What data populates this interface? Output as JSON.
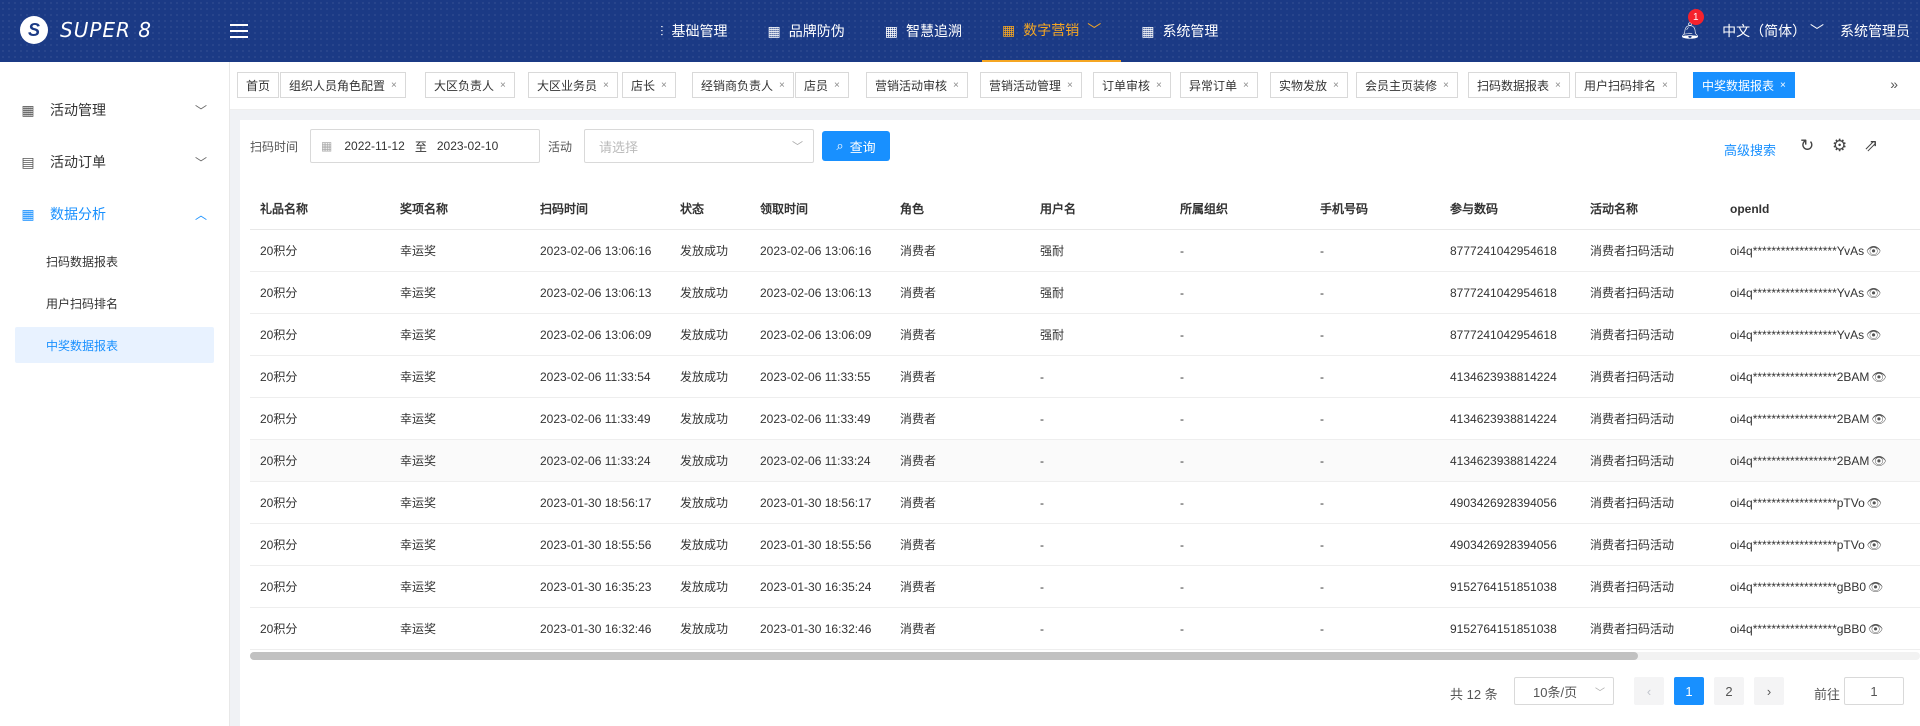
{
  "header": {
    "logo_text": "SUPER 8",
    "nav": [
      {
        "label": "基础管理",
        "icon": "sliders-icon",
        "active": false
      },
      {
        "label": "品牌防伪",
        "icon": "grid-icon",
        "active": false
      },
      {
        "label": "智慧追溯",
        "icon": "grid-icon",
        "active": false
      },
      {
        "label": "数字营销",
        "icon": "grid-icon",
        "active": true
      },
      {
        "label": "系统管理",
        "icon": "grid-icon",
        "active": false
      }
    ],
    "notification_count": "1",
    "language": "中文（简体）",
    "user": "系统管理员",
    "accent_color": "#f5a623",
    "bg_color": "#1b3a85"
  },
  "sidebar": {
    "groups": [
      {
        "label": "活动管理",
        "icon": "grid-icon",
        "open": false
      },
      {
        "label": "活动订单",
        "icon": "document-icon",
        "open": false
      },
      {
        "label": "数据分析",
        "icon": "grid-icon",
        "open": true
      }
    ],
    "subitems": [
      {
        "label": "扫码数据报表",
        "active": false
      },
      {
        "label": "用户扫码排名",
        "active": false
      },
      {
        "label": "中奖数据报表",
        "active": true
      }
    ]
  },
  "tabs": [
    {
      "label": "首页",
      "closable": false
    },
    {
      "label": "组织人员角色配置",
      "closable": true
    },
    {
      "label": "大区负责人",
      "closable": true
    },
    {
      "label": "大区业务员",
      "closable": true
    },
    {
      "label": "店长",
      "closable": true
    },
    {
      "label": "经销商负责人",
      "closable": true
    },
    {
      "label": "店员",
      "closable": true
    },
    {
      "label": "营销活动审核",
      "closable": true
    },
    {
      "label": "营销活动管理",
      "closable": true
    },
    {
      "label": "订单审核",
      "closable": true
    },
    {
      "label": "异常订单",
      "closable": true
    },
    {
      "label": "实物发放",
      "closable": true
    },
    {
      "label": "会员主页装修",
      "closable": true
    },
    {
      "label": "扫码数据报表",
      "closable": true
    },
    {
      "label": "用户扫码排名",
      "closable": true
    },
    {
      "label": "中奖数据报表",
      "closable": true,
      "active": true
    }
  ],
  "filters": {
    "scan_time_label": "扫码时间",
    "date_start": "2022-11-12",
    "date_sep": "至",
    "date_end": "2023-02-10",
    "activity_label": "活动",
    "activity_placeholder": "请选择",
    "query_label": "查询",
    "advanced_search": "高级搜索"
  },
  "table": {
    "columns": [
      "礼品名称",
      "奖项名称",
      "扫码时间",
      "状态",
      "领取时间",
      "角色",
      "用户名",
      "所属组织",
      "手机号码",
      "参与数码",
      "活动名称",
      "openId"
    ],
    "rows": [
      [
        "20积分",
        "幸运奖",
        "2023-02-06 13:06:16",
        "发放成功",
        "2023-02-06 13:06:16",
        "消费者",
        "强耐",
        "-",
        "-",
        "8777241042954618",
        "消费者扫码活动",
        "oi4q******************YvAs"
      ],
      [
        "20积分",
        "幸运奖",
        "2023-02-06 13:06:13",
        "发放成功",
        "2023-02-06 13:06:13",
        "消费者",
        "强耐",
        "-",
        "-",
        "8777241042954618",
        "消费者扫码活动",
        "oi4q******************YvAs"
      ],
      [
        "20积分",
        "幸运奖",
        "2023-02-06 13:06:09",
        "发放成功",
        "2023-02-06 13:06:09",
        "消费者",
        "强耐",
        "-",
        "-",
        "8777241042954618",
        "消费者扫码活动",
        "oi4q******************YvAs"
      ],
      [
        "20积分",
        "幸运奖",
        "2023-02-06 11:33:54",
        "发放成功",
        "2023-02-06 11:33:55",
        "消费者",
        "-",
        "-",
        "-",
        "4134623938814224",
        "消费者扫码活动",
        "oi4q******************2BAM"
      ],
      [
        "20积分",
        "幸运奖",
        "2023-02-06 11:33:49",
        "发放成功",
        "2023-02-06 11:33:49",
        "消费者",
        "-",
        "-",
        "-",
        "4134623938814224",
        "消费者扫码活动",
        "oi4q******************2BAM"
      ],
      [
        "20积分",
        "幸运奖",
        "2023-02-06 11:33:24",
        "发放成功",
        "2023-02-06 11:33:24",
        "消费者",
        "-",
        "-",
        "-",
        "4134623938814224",
        "消费者扫码活动",
        "oi4q******************2BAM"
      ],
      [
        "20积分",
        "幸运奖",
        "2023-01-30 18:56:17",
        "发放成功",
        "2023-01-30 18:56:17",
        "消费者",
        "-",
        "-",
        "-",
        "4903426928394056",
        "消费者扫码活动",
        "oi4q******************pTVo"
      ],
      [
        "20积分",
        "幸运奖",
        "2023-01-30 18:55:56",
        "发放成功",
        "2023-01-30 18:55:56",
        "消费者",
        "-",
        "-",
        "-",
        "4903426928394056",
        "消费者扫码活动",
        "oi4q******************pTVo"
      ],
      [
        "20积分",
        "幸运奖",
        "2023-01-30 16:35:23",
        "发放成功",
        "2023-01-30 16:35:24",
        "消费者",
        "-",
        "-",
        "-",
        "9152764151851038",
        "消费者扫码活动",
        "oi4q******************gBB0"
      ],
      [
        "20积分",
        "幸运奖",
        "2023-01-30 16:32:46",
        "发放成功",
        "2023-01-30 16:32:46",
        "消费者",
        "-",
        "-",
        "-",
        "9152764151851038",
        "消费者扫码活动",
        "oi4q******************gBB0"
      ]
    ]
  },
  "pagination": {
    "total": "共 12 条",
    "page_size": "10条/页",
    "pages": [
      "1",
      "2"
    ],
    "current": "1",
    "goto_label": "前往",
    "goto_value": "1"
  }
}
